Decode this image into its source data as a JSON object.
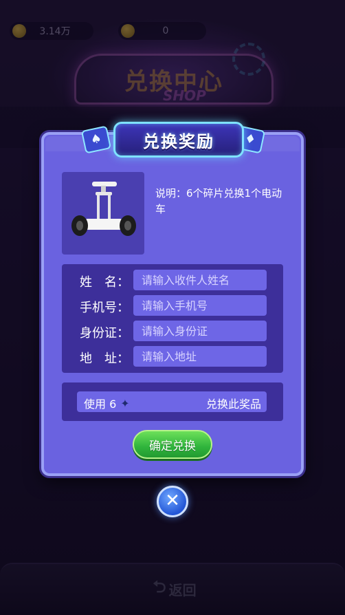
{
  "top_bar": {
    "coin_value": "3.14万",
    "chip_value": "0"
  },
  "background": {
    "title_cn": "兑换中心",
    "title_en": "SHOP",
    "back_label": "返回"
  },
  "modal": {
    "title": "兑换奖励",
    "description": "说明：6个碎片兑换1个电动车",
    "form": {
      "name_label": "姓　名：",
      "name_placeholder": "请输入收件人姓名",
      "phone_label": "手机号：",
      "phone_placeholder": "请输入手机号",
      "id_label": "身份证：",
      "id_placeholder": "请输入身份证",
      "address_label": "地　址：",
      "address_placeholder": "请输入地址"
    },
    "use_text": "使用 6",
    "redeem_label": "兑换此奖品",
    "confirm_label": "确定兑换",
    "close_symbol": "✕"
  },
  "colors": {
    "modal_bg": "#6a62e0",
    "panel_bg": "#3d2f9a",
    "confirm_green": "#2fb43c",
    "banner_glow": "#7fe3ff"
  }
}
